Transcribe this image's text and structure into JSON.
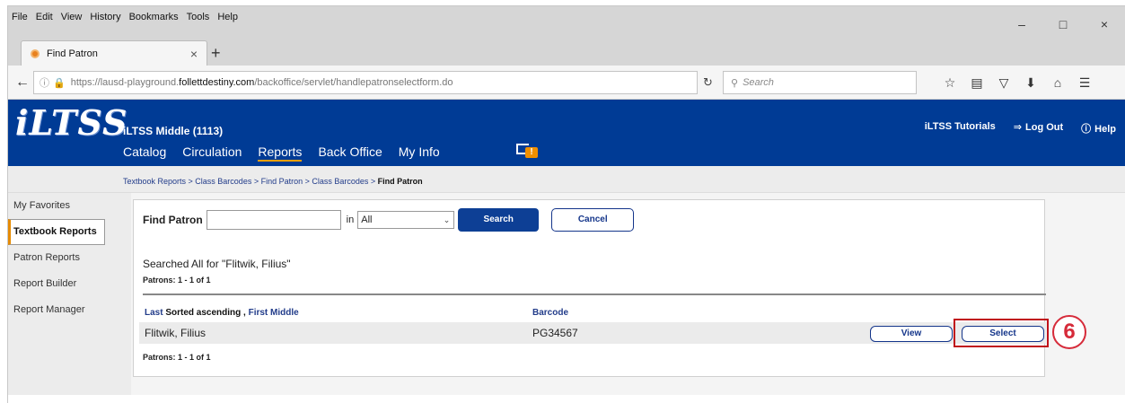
{
  "browser": {
    "menu": [
      "File",
      "Edit",
      "View",
      "History",
      "Bookmarks",
      "Tools",
      "Help"
    ],
    "tab_title": "Find Patron",
    "tab_close": "×",
    "new_tab": "+",
    "url_prefix": "https://lausd-playground.",
    "url_domain": "follettdestiny.com",
    "url_path": "/backoffice/servlet/handlepatronselectform.do",
    "search_placeholder": "Search",
    "window_controls": [
      "–",
      "□",
      "×"
    ]
  },
  "app": {
    "logo": "iLTSS",
    "school": "iLTSS Middle (1113)",
    "nav": [
      "Catalog",
      "Circulation",
      "Reports",
      "Back Office",
      "My Info"
    ],
    "active_nav": "Reports",
    "flag_badge": "!",
    "tutorials": "iLTSS Tutorials",
    "logout": "Log Out",
    "help": "Help"
  },
  "breadcrumb": {
    "trail": "Textbook Reports > Class Barcodes > Find Patron > Class Barcodes > ",
    "current": "Find Patron"
  },
  "sidebar": {
    "items": [
      {
        "label": "My Favorites"
      },
      {
        "label": "Textbook Reports"
      },
      {
        "label": "Patron Reports"
      },
      {
        "label": "Report Builder"
      },
      {
        "label": "Report Manager"
      }
    ]
  },
  "find": {
    "label": "Find Patron",
    "input_value": "",
    "in_label": "in",
    "scope": "All",
    "search_btn": "Search",
    "cancel_btn": "Cancel"
  },
  "results": {
    "searched_text": "Searched All for \"Flitwik, Filius\"",
    "count_top": "Patrons: 1 - 1 of 1",
    "count_bottom": "Patrons: 1 - 1 of 1",
    "col_last": "Last",
    "col_sort": "Sorted ascending",
    "col_first": "First",
    "col_middle": "Middle",
    "col_barcode": "Barcode",
    "rows": [
      {
        "name": "Flitwik, Filius",
        "barcode": "PG34567"
      }
    ],
    "view_btn": "View",
    "select_btn": "Select"
  },
  "annotation": {
    "step": "6",
    "color": "#c0111a"
  }
}
